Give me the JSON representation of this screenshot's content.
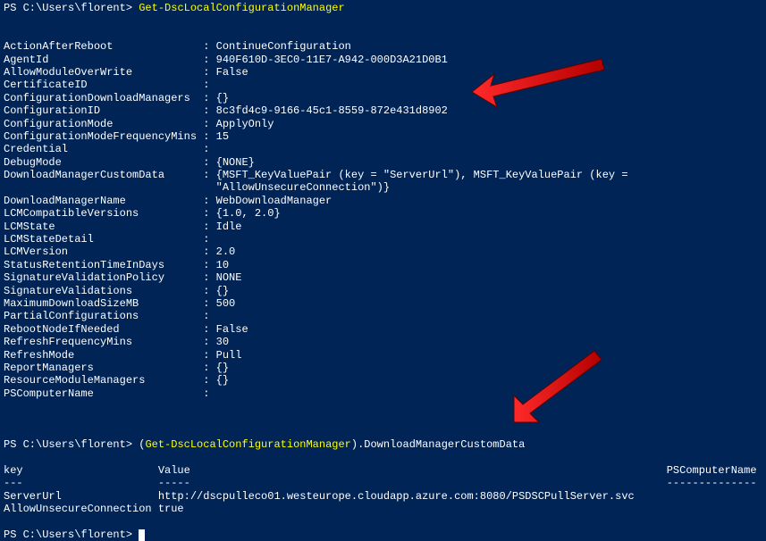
{
  "prompt1": "PS C:\\Users\\florent> ",
  "cmd1": "Get-DscLocalConfigurationManager",
  "blank": "",
  "config": {
    "rows": [
      {
        "k": "ActionAfterReboot              ",
        "sep": ": ",
        "v": "ContinueConfiguration"
      },
      {
        "k": "AgentId                        ",
        "sep": ": ",
        "v": "940F610D-3EC0-11E7-A942-000D3A21D0B1"
      },
      {
        "k": "AllowModuleOverWrite           ",
        "sep": ": ",
        "v": "False"
      },
      {
        "k": "CertificateID                  ",
        "sep": ":",
        "v": ""
      },
      {
        "k": "ConfigurationDownloadManagers  ",
        "sep": ": ",
        "v": "{}"
      },
      {
        "k": "ConfigurationID                ",
        "sep": ": ",
        "v": "8c3fd4c9-9166-45c1-8559-872e431d8902"
      },
      {
        "k": "ConfigurationMode              ",
        "sep": ": ",
        "v": "ApplyOnly"
      },
      {
        "k": "ConfigurationModeFrequencyMins ",
        "sep": ": ",
        "v": "15"
      },
      {
        "k": "Credential                     ",
        "sep": ":",
        "v": ""
      },
      {
        "k": "DebugMode                      ",
        "sep": ": ",
        "v": "{NONE}"
      },
      {
        "k": "DownloadManagerCustomData      ",
        "sep": ": ",
        "v": "{MSFT_KeyValuePair (key = \"ServerUrl\"), MSFT_KeyValuePair (key ="
      },
      {
        "k": "                               ",
        "sep": "  ",
        "v": "\"AllowUnsecureConnection\")}"
      },
      {
        "k": "DownloadManagerName            ",
        "sep": ": ",
        "v": "WebDownloadManager"
      },
      {
        "k": "LCMCompatibleVersions          ",
        "sep": ": ",
        "v": "{1.0, 2.0}"
      },
      {
        "k": "LCMState                       ",
        "sep": ": ",
        "v": "Idle"
      },
      {
        "k": "LCMStateDetail                 ",
        "sep": ":",
        "v": ""
      },
      {
        "k": "LCMVersion                     ",
        "sep": ": ",
        "v": "2.0"
      },
      {
        "k": "StatusRetentionTimeInDays      ",
        "sep": ": ",
        "v": "10"
      },
      {
        "k": "SignatureValidationPolicy      ",
        "sep": ": ",
        "v": "NONE"
      },
      {
        "k": "SignatureValidations           ",
        "sep": ": ",
        "v": "{}"
      },
      {
        "k": "MaximumDownloadSizeMB          ",
        "sep": ": ",
        "v": "500"
      },
      {
        "k": "PartialConfigurations          ",
        "sep": ":",
        "v": ""
      },
      {
        "k": "RebootNodeIfNeeded             ",
        "sep": ": ",
        "v": "False"
      },
      {
        "k": "RefreshFrequencyMins           ",
        "sep": ": ",
        "v": "30"
      },
      {
        "k": "RefreshMode                    ",
        "sep": ": ",
        "v": "Pull"
      },
      {
        "k": "ReportManagers                 ",
        "sep": ": ",
        "v": "{}"
      },
      {
        "k": "ResourceModuleManagers         ",
        "sep": ": ",
        "v": "{}"
      },
      {
        "k": "PSComputerName                 ",
        "sep": ":",
        "v": ""
      }
    ]
  },
  "prompt2_prefix": "PS C:\\Users\\florent> ",
  "prompt2_open": "(",
  "cmd2": "Get-DscLocalConfigurationManager",
  "prompt2_close": ")",
  "prompt2_prop": ".DownloadManagerCustomData",
  "table": {
    "header": "key                     Value                                                                          PSComputerName",
    "divider": "---                     -----                                                                          --------------",
    "row1": "ServerUrl               http://dscpulleco01.westeurope.cloudapp.azure.com:8080/PSDSCPullServer.svc",
    "row2": "AllowUnsecureConnection true"
  },
  "prompt3": "PS C:\\Users\\florent> "
}
